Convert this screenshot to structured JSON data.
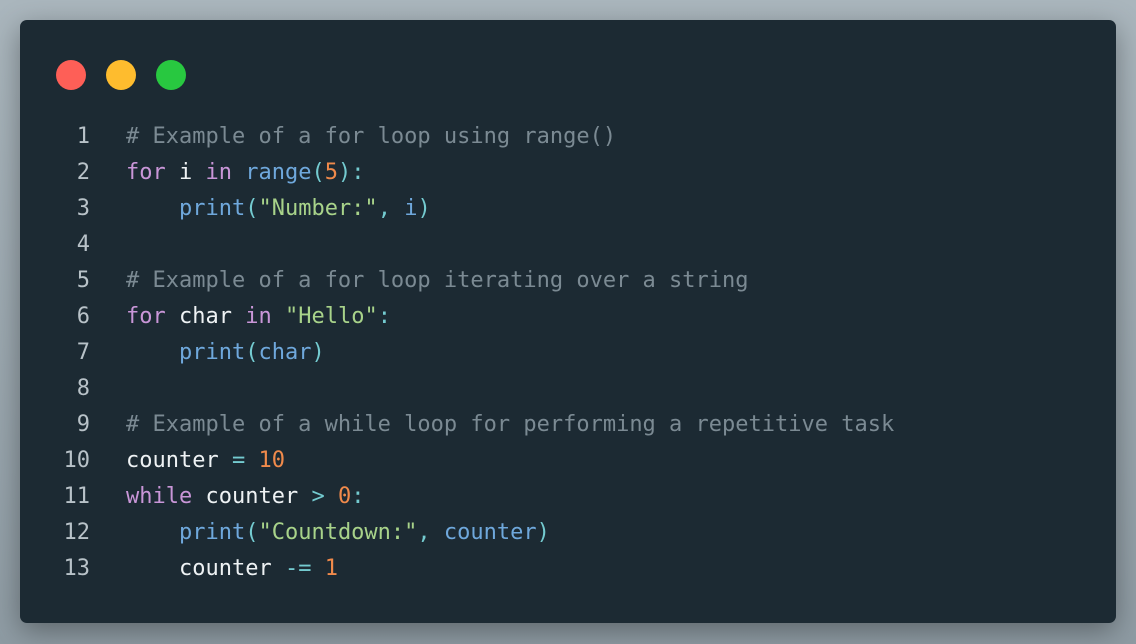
{
  "window": {
    "controls": [
      {
        "name": "close",
        "color": "#fe5f57"
      },
      {
        "name": "minimize",
        "color": "#febc2e"
      },
      {
        "name": "maximize",
        "color": "#28c840"
      }
    ]
  },
  "colors": {
    "background": "#1c2a33",
    "comment": "#7b8a93",
    "keyword": "#c996d8",
    "builtin": "#6fa8dc",
    "number": "#f08a4b",
    "string": "#a8d38a",
    "punctuation": "#74cbd0",
    "identifier": "#eef2f4"
  },
  "code": {
    "language": "python",
    "lines": [
      {
        "number": "1",
        "indent": "",
        "tokens": [
          {
            "t": "# Example of a for loop using range()",
            "k": "comment"
          }
        ]
      },
      {
        "number": "2",
        "indent": "",
        "tokens": [
          {
            "t": "for",
            "k": "keyword"
          },
          {
            "t": " ",
            "k": "var"
          },
          {
            "t": "i",
            "k": "var"
          },
          {
            "t": " ",
            "k": "var"
          },
          {
            "t": "in",
            "k": "keyword"
          },
          {
            "t": " ",
            "k": "var"
          },
          {
            "t": "range",
            "k": "builtin"
          },
          {
            "t": "(",
            "k": "punct"
          },
          {
            "t": "5",
            "k": "number"
          },
          {
            "t": "):",
            "k": "punct"
          }
        ]
      },
      {
        "number": "3",
        "indent": "    ",
        "tokens": [
          {
            "t": "print",
            "k": "builtin"
          },
          {
            "t": "(",
            "k": "punct"
          },
          {
            "t": "\"Number:\"",
            "k": "string"
          },
          {
            "t": ", ",
            "k": "punct"
          },
          {
            "t": "i",
            "k": "param"
          },
          {
            "t": ")",
            "k": "punct"
          }
        ]
      },
      {
        "number": "4",
        "indent": "",
        "tokens": []
      },
      {
        "number": "5",
        "indent": "",
        "tokens": [
          {
            "t": "# Example of a for loop iterating over a string",
            "k": "comment"
          }
        ]
      },
      {
        "number": "6",
        "indent": "",
        "tokens": [
          {
            "t": "for",
            "k": "keyword"
          },
          {
            "t": " ",
            "k": "var"
          },
          {
            "t": "char",
            "k": "var"
          },
          {
            "t": " ",
            "k": "var"
          },
          {
            "t": "in",
            "k": "keyword"
          },
          {
            "t": " ",
            "k": "var"
          },
          {
            "t": "\"Hello\"",
            "k": "string"
          },
          {
            "t": ":",
            "k": "punct"
          }
        ]
      },
      {
        "number": "7",
        "indent": "    ",
        "tokens": [
          {
            "t": "print",
            "k": "builtin"
          },
          {
            "t": "(",
            "k": "punct"
          },
          {
            "t": "char",
            "k": "param"
          },
          {
            "t": ")",
            "k": "punct"
          }
        ]
      },
      {
        "number": "8",
        "indent": "",
        "tokens": []
      },
      {
        "number": "9",
        "indent": "",
        "tokens": [
          {
            "t": "# Example of a while loop for performing a repetitive task",
            "k": "comment"
          }
        ]
      },
      {
        "number": "10",
        "indent": "",
        "tokens": [
          {
            "t": "counter",
            "k": "var"
          },
          {
            "t": " ",
            "k": "var"
          },
          {
            "t": "=",
            "k": "op"
          },
          {
            "t": " ",
            "k": "var"
          },
          {
            "t": "10",
            "k": "number"
          }
        ]
      },
      {
        "number": "11",
        "indent": "",
        "tokens": [
          {
            "t": "while",
            "k": "keyword"
          },
          {
            "t": " ",
            "k": "var"
          },
          {
            "t": "counter",
            "k": "var"
          },
          {
            "t": " ",
            "k": "var"
          },
          {
            "t": ">",
            "k": "op"
          },
          {
            "t": " ",
            "k": "var"
          },
          {
            "t": "0",
            "k": "number"
          },
          {
            "t": ":",
            "k": "punct"
          }
        ]
      },
      {
        "number": "12",
        "indent": "    ",
        "tokens": [
          {
            "t": "print",
            "k": "builtin"
          },
          {
            "t": "(",
            "k": "punct"
          },
          {
            "t": "\"Countdown:\"",
            "k": "string"
          },
          {
            "t": ", ",
            "k": "punct"
          },
          {
            "t": "counter",
            "k": "param"
          },
          {
            "t": ")",
            "k": "punct"
          }
        ]
      },
      {
        "number": "13",
        "indent": "    ",
        "tokens": [
          {
            "t": "counter",
            "k": "var"
          },
          {
            "t": " ",
            "k": "var"
          },
          {
            "t": "-=",
            "k": "op"
          },
          {
            "t": " ",
            "k": "var"
          },
          {
            "t": "1",
            "k": "number"
          }
        ]
      }
    ]
  }
}
